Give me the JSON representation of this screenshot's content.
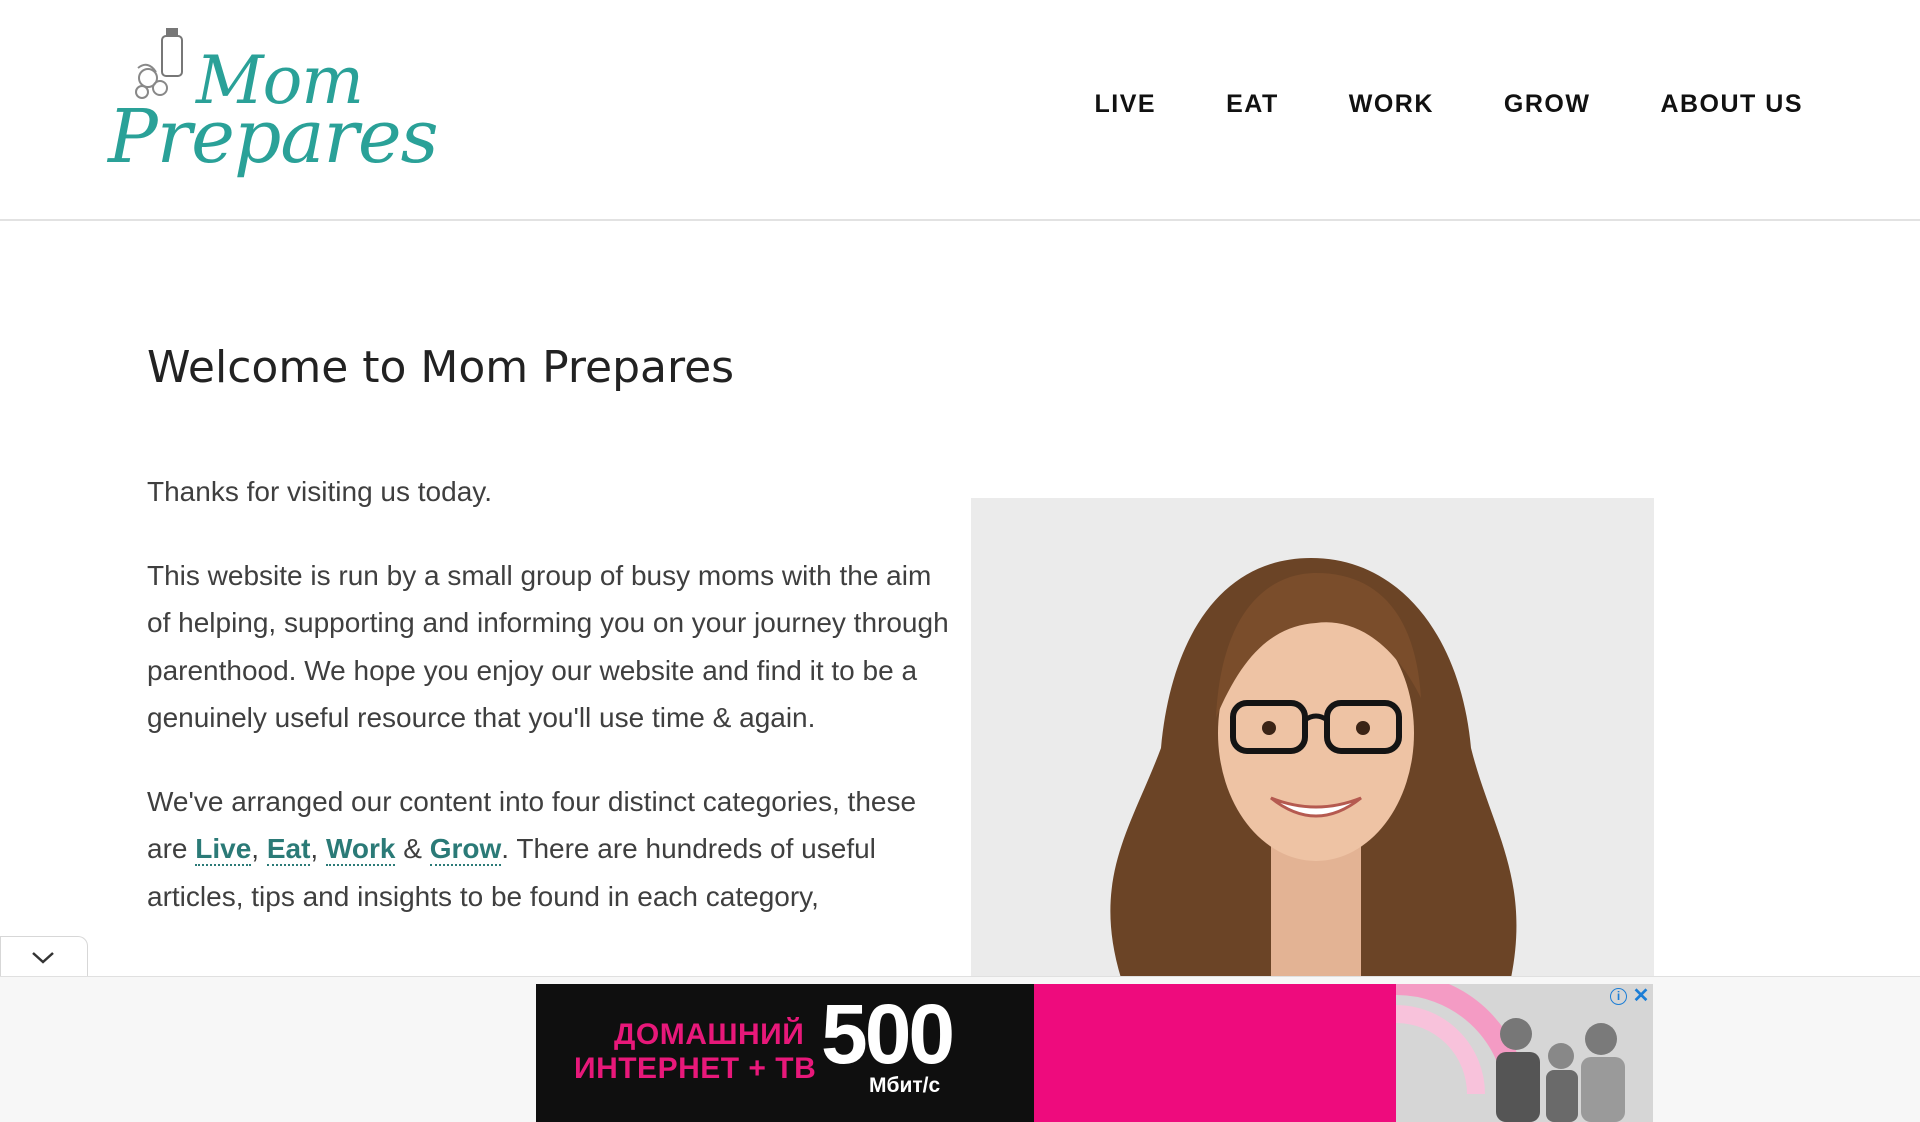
{
  "header": {
    "logo": {
      "line1": "Mom",
      "line2": "Prepares"
    },
    "nav": [
      "LIVE",
      "EAT",
      "WORK",
      "GROW",
      "ABOUT US"
    ]
  },
  "main": {
    "title": "Welcome to Mom Prepares",
    "intro": "Thanks for visiting us today.",
    "about": "This website is run by a small group of busy moms with the aim of helping, supporting and informing you on your journey through parenthood. We hope you enjoy our website and find it to be a genuinely useful resource that you'll use time & again.",
    "categories": {
      "prefix": "We've arranged our content into four distinct categories, these are ",
      "links": [
        "Live",
        "Eat",
        "Work",
        "Grow"
      ],
      "sep1": ", ",
      "sep2": ", ",
      "sep3": " & ",
      "suffix": ". There are hundreds of useful articles, tips and insights to be found in each category,"
    }
  },
  "ad": {
    "line1": "ДОМАШНИЙ",
    "line2": "ИНТЕРНЕТ + ТВ",
    "number": "500",
    "unit": "Мбит/с",
    "info_icon": "i",
    "close_icon": "✕",
    "accent": "#ee0b7d"
  },
  "colors": {
    "brand": "#2aa198",
    "link": "#2b7a77"
  }
}
